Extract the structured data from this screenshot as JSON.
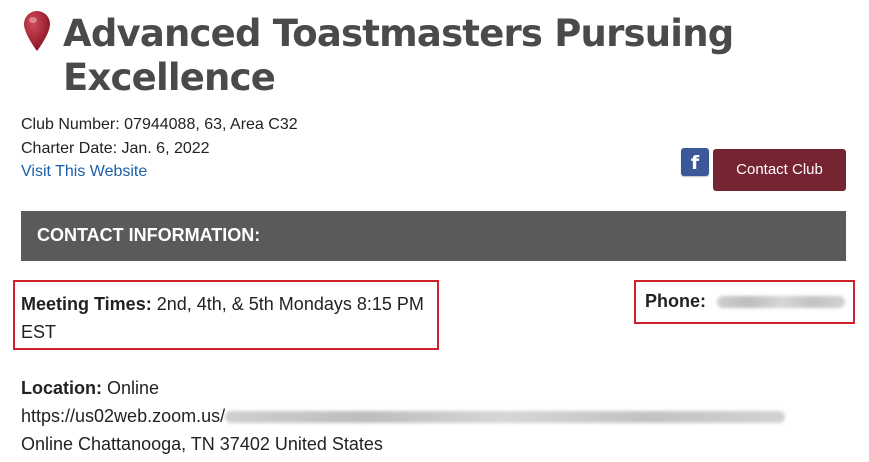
{
  "club": {
    "title": "Advanced Toastmasters Pursuing Excellence",
    "club_number": "Club Number: 07944088, 63, Area C32",
    "charter_date": "Charter Date: Jan. 6, 2022",
    "website_link": "Visit This Website"
  },
  "actions": {
    "facebook_icon": "f",
    "contact_button": "Contact Club"
  },
  "section": {
    "header": "CONTACT INFORMATION:"
  },
  "meeting": {
    "label": "Meeting Times:",
    "value": "2nd, 4th, & 5th Mondays 8:15 PM EST"
  },
  "phone": {
    "label": "Phone:"
  },
  "location": {
    "label": "Location:",
    "value": "Online",
    "url_prefix": "https://us02web.zoom.us/",
    "address": "Online Chattanooga, TN 37402  United States"
  },
  "colors": {
    "title": "#4a4a4a",
    "link": "#1a5fa8",
    "button": "#772432",
    "facebook": "#3b5998",
    "section_bg": "#5a5a5a",
    "highlight_box": "#d0202a"
  }
}
